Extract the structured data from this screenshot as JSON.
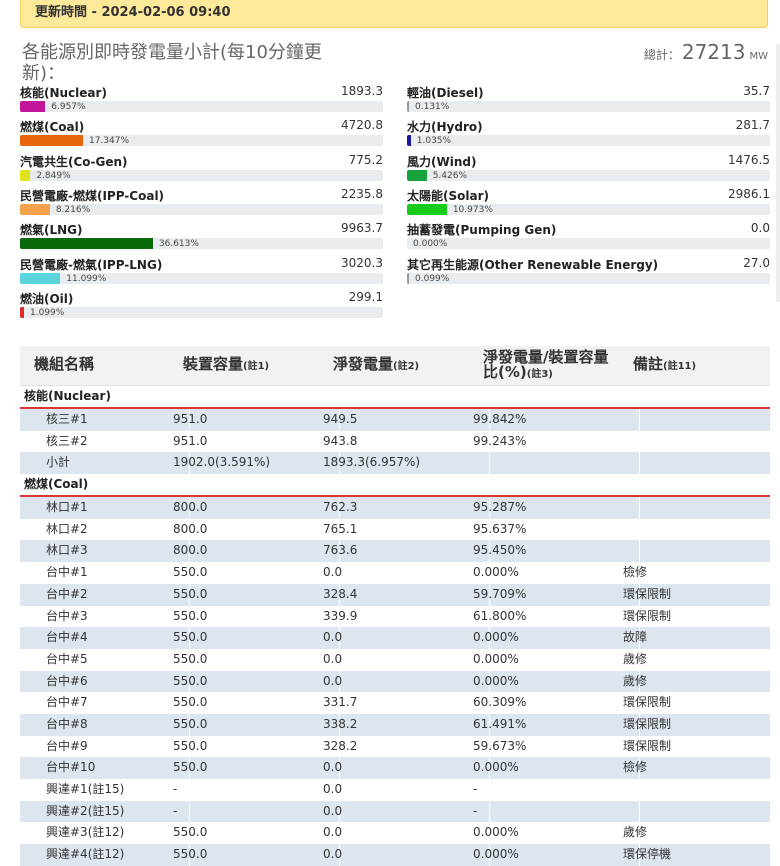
{
  "header": {
    "update_time": "更新時間 - 2024-02-06 09:40"
  },
  "summary": {
    "title": "各能源別即時發電量小計(每10分鐘更新)：",
    "total_label": "總計：",
    "total_value": "27213",
    "total_unit": "MW"
  },
  "sources_left": [
    {
      "name": "核能(Nuclear)",
      "value": "1893.3",
      "percent": "6.957%",
      "share": 6.957,
      "color": "#c1169c"
    },
    {
      "name": "燃煤(Coal)",
      "value": "4720.8",
      "percent": "17.347%",
      "share": 17.347,
      "color": "#e8670c"
    },
    {
      "name": "汽電共生(Co-Gen)",
      "value": "775.2",
      "percent": "2.849%",
      "share": 2.849,
      "color": "#e2e21a"
    },
    {
      "name": "民營電廠-燃煤(IPP-Coal)",
      "value": "2235.8",
      "percent": "8.216%",
      "share": 8.216,
      "color": "#f7a14d"
    },
    {
      "name": "燃氣(LNG)",
      "value": "9963.7",
      "percent": "36.613%",
      "share": 36.613,
      "color": "#0a6a0a"
    },
    {
      "name": "民營電廠-燃氣(IPP-LNG)",
      "value": "3020.3",
      "percent": "11.099%",
      "share": 11.099,
      "color": "#5bd3dc"
    },
    {
      "name": "燃油(Oil)",
      "value": "299.1",
      "percent": "1.099%",
      "share": 1.099,
      "color": "#e02b2b"
    }
  ],
  "sources_right": [
    {
      "name": "輕油(Diesel)",
      "value": "35.7",
      "percent": "0.131%",
      "share": 0.131,
      "color": "#999999"
    },
    {
      "name": "水力(Hydro)",
      "value": "281.7",
      "percent": "1.035%",
      "share": 1.035,
      "color": "#1a1a9a"
    },
    {
      "name": "風力(Wind)",
      "value": "1476.5",
      "percent": "5.426%",
      "share": 5.426,
      "color": "#17a33c"
    },
    {
      "name": "太陽能(Solar)",
      "value": "2986.1",
      "percent": "10.973%",
      "share": 10.973,
      "color": "#19cc1c"
    },
    {
      "name": "抽蓄發電(Pumping Gen)",
      "value": "0.0",
      "percent": "0.000%",
      "share": 0,
      "color": "#999999"
    },
    {
      "name": "其它再生能源(Other Renewable Energy)",
      "value": "27.0",
      "percent": "0.099%",
      "share": 0.099,
      "color": "#999999"
    }
  ],
  "table": {
    "headers": [
      {
        "text": "機組名稱",
        "note": ""
      },
      {
        "text": "裝置容量",
        "note": "(註1)"
      },
      {
        "text": "淨發電量",
        "note": "(註2)"
      },
      {
        "text": "淨發電量/裝置容量比(%)",
        "note": "(註3)"
      },
      {
        "text": "備註",
        "note": "(註11)"
      }
    ],
    "groups": [
      {
        "name": "核能(Nuclear)",
        "rows": [
          [
            "核三#1",
            "951.0",
            "949.5",
            "99.842%",
            ""
          ],
          [
            "核三#2",
            "951.0",
            "943.8",
            "99.243%",
            ""
          ],
          [
            "小計",
            "1902.0(3.591%)",
            "1893.3(6.957%)",
            "",
            ""
          ]
        ]
      },
      {
        "name": "燃煤(Coal)",
        "rows": [
          [
            "林口#1",
            "800.0",
            "762.3",
            "95.287%",
            ""
          ],
          [
            "林口#2",
            "800.0",
            "765.1",
            "95.637%",
            ""
          ],
          [
            "林口#3",
            "800.0",
            "763.6",
            "95.450%",
            ""
          ],
          [
            "台中#1",
            "550.0",
            "0.0",
            "0.000%",
            "檢修"
          ],
          [
            "台中#2",
            "550.0",
            "328.4",
            "59.709%",
            "環保限制"
          ],
          [
            "台中#3",
            "550.0",
            "339.9",
            "61.800%",
            "環保限制"
          ],
          [
            "台中#4",
            "550.0",
            "0.0",
            "0.000%",
            "故障"
          ],
          [
            "台中#5",
            "550.0",
            "0.0",
            "0.000%",
            "歲修"
          ],
          [
            "台中#6",
            "550.0",
            "0.0",
            "0.000%",
            "歲修"
          ],
          [
            "台中#7",
            "550.0",
            "331.7",
            "60.309%",
            "環保限制"
          ],
          [
            "台中#8",
            "550.0",
            "338.2",
            "61.491%",
            "環保限制"
          ],
          [
            "台中#9",
            "550.0",
            "328.2",
            "59.673%",
            "環保限制"
          ],
          [
            "台中#10",
            "550.0",
            "0.0",
            "0.000%",
            "檢修"
          ],
          [
            "興達#1(註15)",
            "-",
            "0.0",
            "-",
            ""
          ],
          [
            "興達#2(註15)",
            "-",
            "0.0",
            "-",
            ""
          ],
          [
            "興達#3(註12)",
            "550.0",
            "0.0",
            "0.000%",
            "歲修"
          ],
          [
            "興達#4(註12)",
            "550.0",
            "0.0",
            "0.000%",
            "環保停機"
          ]
        ]
      }
    ]
  }
}
